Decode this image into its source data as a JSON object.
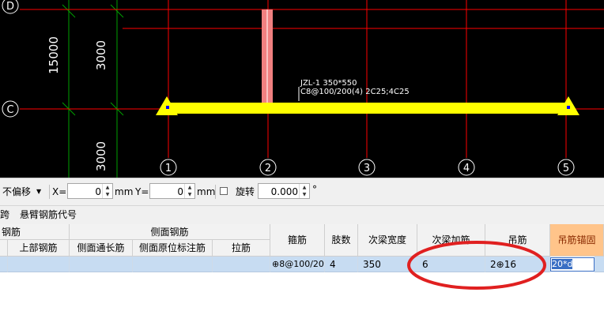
{
  "canvas": {
    "axis_rows": [
      "D",
      "C"
    ],
    "axis_cols": [
      "1",
      "2",
      "3",
      "4",
      "5"
    ],
    "dim_total": "15000",
    "dim_upper": "3000",
    "dim_lower": "3000",
    "beam_label_line1": "JZL-1 350*550",
    "beam_label_line2": "C8@100/200(4) 2C25;4C25"
  },
  "toolbar": {
    "offset_select": "不偏移",
    "x_label": "X=",
    "x_value": "0",
    "x_unit": "mm",
    "y_label": "Y=",
    "y_value": "0",
    "y_unit": "mm",
    "rotate_label": "旋转",
    "rotate_value": "0.000",
    "degree": "°"
  },
  "subtabs": {
    "tab1": "跨",
    "tab2": "悬臂钢筋代号"
  },
  "table": {
    "group_left": "钢筋",
    "group_side": "侧面钢筋",
    "col_top": "上部钢筋",
    "col_side_long": "侧面通长筋",
    "col_side_orig": "侧面原位标注筋",
    "col_tie": "拉筋",
    "col_stirrup": "箍筋",
    "col_legs": "肢数",
    "col_sec_width": "次梁宽度",
    "col_sec_add": "次梁加筋",
    "col_hanger": "吊筋",
    "col_hanger_anchor": "吊筋锚固",
    "row": {
      "stirrup": "⊕8@100/20",
      "legs": "4",
      "sec_width": "350",
      "sec_add": "6",
      "hanger": "2⊕16",
      "hanger_anchor": "20*d"
    }
  },
  "colors": {
    "beam": "#ffff00",
    "axis_line": "#ff0000",
    "axis_green": "#00a000",
    "column": "#f08080",
    "highlight_ellipse": "#e02020",
    "selected_row": "#c7dcf2",
    "active_header": "#ffc48a"
  }
}
